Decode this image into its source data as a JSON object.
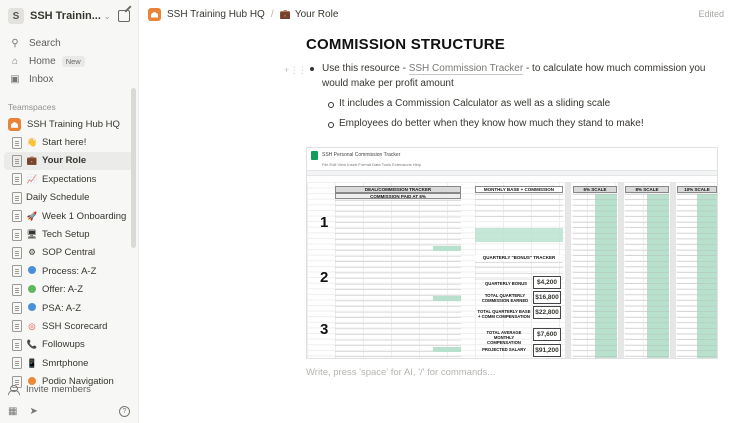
{
  "workspace": {
    "badge": "S",
    "name": "SSH Trainin..."
  },
  "nav": [
    {
      "icon": "🔍",
      "label": "Search",
      "badge": ""
    },
    {
      "icon": "⌂",
      "label": "Home",
      "badge": "New"
    },
    {
      "icon": "▭",
      "label": "Inbox",
      "badge": ""
    }
  ],
  "section_label": "Teamspaces",
  "tree": [
    {
      "icon": "home",
      "label": "SSH Training Hub HQ",
      "level": 0
    },
    {
      "icon": "👋",
      "label": "Start here!",
      "level": 1
    },
    {
      "icon": "💼",
      "label": "Your Role",
      "level": 1,
      "active": true
    },
    {
      "icon": "📈",
      "label": "Expectations",
      "level": 1
    },
    {
      "icon": "",
      "label": "Daily Schedule",
      "level": 1
    },
    {
      "icon": "🚀",
      "label": "Week 1 Onboarding",
      "level": 1
    },
    {
      "icon": "🖥",
      "label": "Tech Setup",
      "level": 1
    },
    {
      "icon": "⚙",
      "label": "SOP Central",
      "level": 1
    },
    {
      "icon": "dot-blue",
      "label": "Process: A-Z",
      "level": 1
    },
    {
      "icon": "dot-green",
      "label": "Offer: A-Z",
      "level": 1
    },
    {
      "icon": "dot-blue",
      "label": "PSA: A-Z",
      "level": 1
    },
    {
      "icon": "◎",
      "label": "SSH Scorecard",
      "level": 1
    },
    {
      "icon": "📞",
      "label": "Followups",
      "level": 1
    },
    {
      "icon": "📱",
      "label": "Smrtphone",
      "level": 1
    },
    {
      "icon": "dot-orange",
      "label": "Podio Navigation",
      "level": 1
    }
  ],
  "invite_label": "Invite members",
  "breadcrumb": {
    "items": [
      {
        "icon": "home",
        "label": "SSH Training Hub HQ"
      },
      {
        "icon": "💼",
        "label": "Your Role"
      }
    ],
    "separator": "/",
    "status": "Edited"
  },
  "page": {
    "heading": "COMMISSION STRUCTURE",
    "bullet1_prefix": "Use this resource - ",
    "bullet1_link": "SSH Commission Tracker",
    "bullet1_suffix": " - to calculate how much commission you would make per profit amount",
    "sub1": "It includes a Commission Calculator as well as a sliding scale",
    "sub2": "Employees do better when they know how much they stand to make!",
    "placeholder": "Write, press 'space' for AI, '/' for commands..."
  },
  "sheet": {
    "title": "SSH Personal Commission Tracker",
    "menu": "File   Edit   View   Insert   Format   Data   Tools   Extensions   Help",
    "left_header": "DEAL/COMMISSION TRACKER",
    "left_sub": "COMMISSION PAID AT 6%",
    "mid_header": "MONTHLY BASE + COMMISSION",
    "q_header": "QUARTERLY \"BONUS\" TRACKER",
    "s6": "6% SCALE",
    "s8": "8% SCALE",
    "s10": "10% SCALE",
    "num1": "1",
    "num2": "2",
    "num3": "3",
    "quarterly_bonus_label": "QUARTERLY BONUS",
    "quarterly_bonus": "$4,200",
    "total_quarterly_label": "TOTAL QUARTERLY COMMISSION EARNED",
    "total_quarterly": "$16,800",
    "base_comm_label": "TOTAL QUARTERLY BASE + COMM COMPENSATION",
    "base_comm": "$22,800",
    "avg_label": "TOTAL AVERAGE MONTHLY COMPENSATION",
    "avg": "$7,600",
    "proj_label": "PROJECTED SALARY",
    "proj": "$91,200"
  }
}
